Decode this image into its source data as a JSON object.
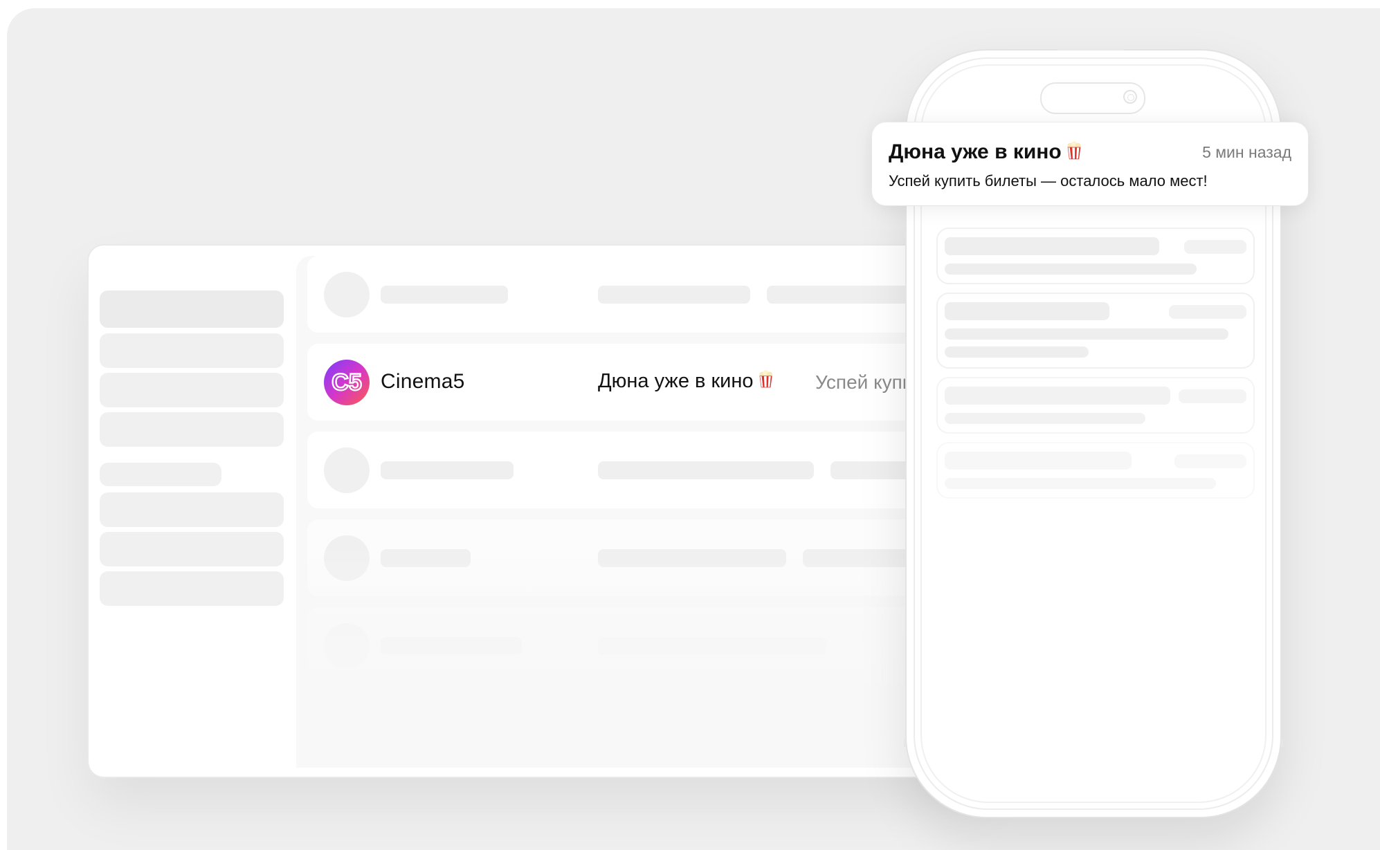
{
  "messages_list": {
    "active_row": {
      "sender": "Cinema5",
      "logo_text": "C5",
      "title": "Дюна уже в кино",
      "preview": "Успей купи",
      "title_icon": "popcorn-icon"
    }
  },
  "notification": {
    "title": "Дюна уже в кино",
    "title_icon": "popcorn-icon",
    "time": "5 мин назад",
    "body": "Успей купить билеты — осталось мало мест!"
  },
  "colors": {
    "background": "#efefef",
    "skeleton": "#efefef",
    "logo_gradient": [
      "#7a3dff",
      "#d437c9",
      "#ff5a4e"
    ],
    "popcorn_red": "#e0312b"
  }
}
